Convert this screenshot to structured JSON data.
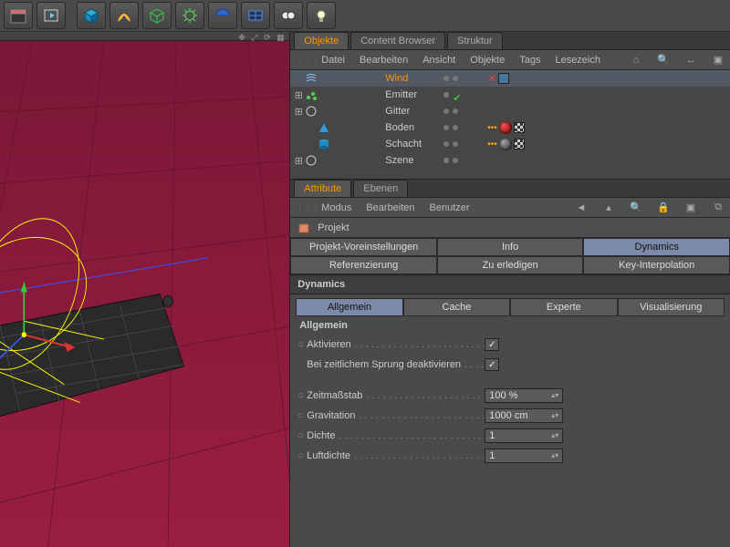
{
  "top_toolbar": {
    "icons": [
      "clapper",
      "frame",
      "cube",
      "coil",
      "cube-wire",
      "gear",
      "sphere-half",
      "grid",
      "goggles",
      "light"
    ]
  },
  "panels": {
    "objects": {
      "tabs": [
        "Objekte",
        "Content Browser",
        "Struktur"
      ],
      "active": 0,
      "menu": [
        "Datei",
        "Bearbeiten",
        "Ansicht",
        "Objekte",
        "Tags",
        "Lesezeich"
      ]
    },
    "attributes": {
      "tabs": [
        "Attribute",
        "Ebenen"
      ],
      "active": 0,
      "menu": [
        "Modus",
        "Bearbeiten",
        "Benutzer"
      ]
    }
  },
  "objects": [
    {
      "name": "Wind",
      "depth": 0,
      "expander": "",
      "icon": "wind",
      "vis": [
        "r",
        "d"
      ],
      "tags": [
        "x",
        "grid"
      ],
      "selected": true
    },
    {
      "name": "Emitter",
      "depth": 0,
      "expander": "+",
      "icon": "emitter",
      "vis": [
        "d",
        "g"
      ],
      "tags": []
    },
    {
      "name": "Gitter",
      "depth": 0,
      "expander": "+",
      "icon": "null",
      "vis": [
        "d",
        "d"
      ],
      "tags": []
    },
    {
      "name": "Boden",
      "depth": 1,
      "expander": "",
      "icon": "cone",
      "vis": [
        "d",
        "d"
      ],
      "tags": [
        "dots",
        "sphere-red",
        "checker"
      ]
    },
    {
      "name": "Schacht",
      "depth": 1,
      "expander": "",
      "icon": "cyl",
      "vis": [
        "d",
        "d"
      ],
      "tags": [
        "dots",
        "sphere-dark",
        "checker"
      ]
    },
    {
      "name": "Szene",
      "depth": 0,
      "expander": "+",
      "icon": "null",
      "vis": [
        "d",
        "d"
      ],
      "tags": []
    }
  ],
  "attr": {
    "header": "Projekt",
    "row1": [
      "Projekt-Voreinstellungen",
      "Info",
      "Dynamics"
    ],
    "row1_selected": 2,
    "row2": [
      "Referenzierung",
      "Zu erledigen",
      "Key-Interpolation"
    ],
    "section": "Dynamics",
    "subtabs": [
      "Allgemein",
      "Cache",
      "Experte",
      "Visualisierung"
    ],
    "subtab_selected": 0,
    "group": "Allgemein",
    "props": {
      "aktivieren_label": "Aktivieren",
      "aktivieren_checked": true,
      "deaktivieren_label": "Bei zeitlichem Sprung deaktivieren",
      "deaktivieren_checked": true,
      "zeitmassstab_label": "Zeitmaßstab",
      "zeitmassstab_value": "100 %",
      "gravitation_label": "Gravitation",
      "gravitation_value": "1000 cm",
      "dichte_label": "Dichte",
      "dichte_value": "1",
      "luftdichte_label": "Luftdichte",
      "luftdichte_value": "1"
    }
  }
}
